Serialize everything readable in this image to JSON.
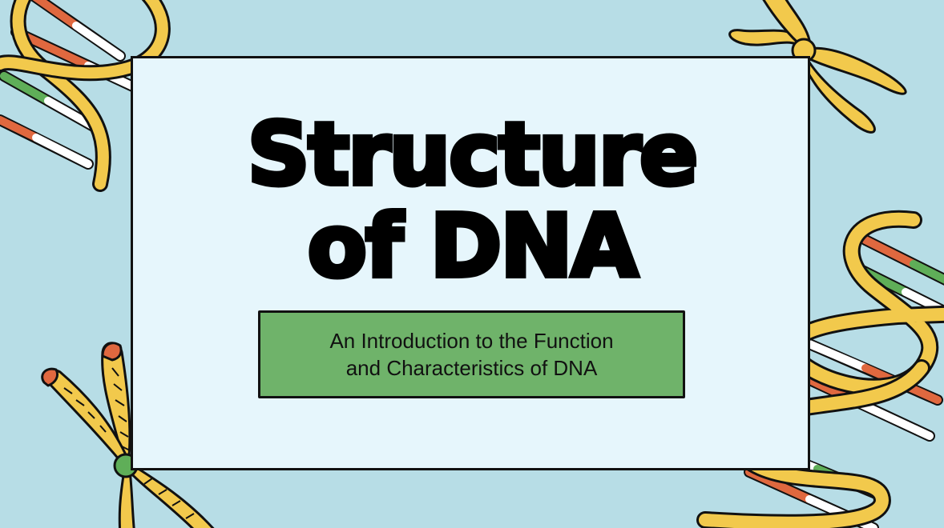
{
  "slide": {
    "title_line1": "Structure",
    "title_line2": "of DNA",
    "subtitle_line1": "An Introduction to the Function",
    "subtitle_line2": "and Characteristics of DNA"
  },
  "decorations": {
    "top_left": "dna-helix-icon",
    "top_right": "chromosome-icon",
    "bottom_left": "chromosome-icon",
    "bottom_right": "dna-helix-icon"
  },
  "colors": {
    "background": "#b7dde6",
    "card": "#e6f6fc",
    "subtitle_box": "#6fb36a",
    "helix_yellow": "#f2c94c",
    "rung_orange": "#e0683f",
    "rung_green": "#5fae58",
    "outline": "#111111"
  }
}
